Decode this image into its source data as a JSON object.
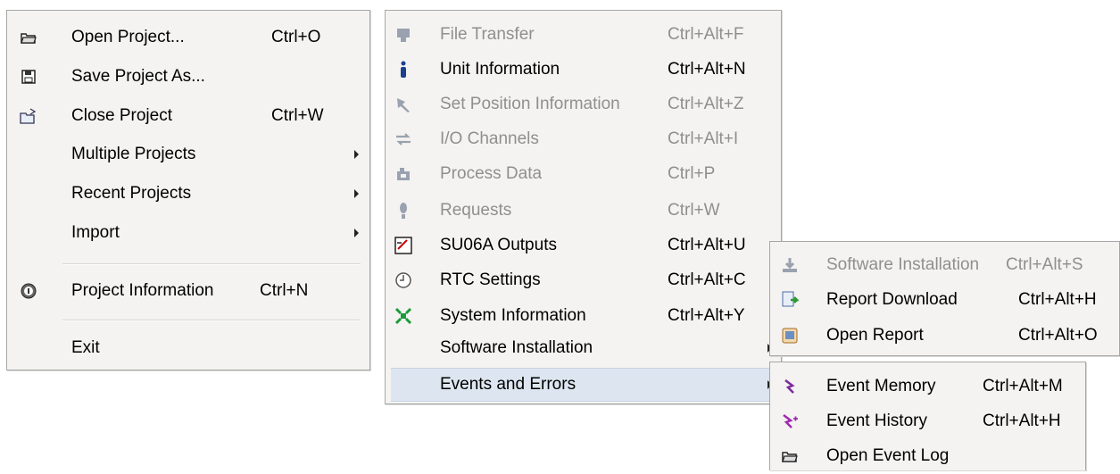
{
  "file_menu": {
    "items": [
      {
        "label": "Open Project...",
        "accel": "Ctrl+O",
        "icon": "folder-open-icon"
      },
      {
        "label": "Save Project As...",
        "accel": "",
        "icon": "floppy-save-icon"
      },
      {
        "label": "Close Project",
        "accel": "Ctrl+W",
        "icon": "folder-close-icon"
      },
      {
        "label": "Multiple Projects",
        "accel": ""
      },
      {
        "label": "Recent Projects",
        "accel": ""
      },
      {
        "label": "Import",
        "accel": ""
      },
      {
        "label": "Project Information",
        "accel": "Ctrl+N",
        "icon": "info-badge-icon"
      },
      {
        "label": "Exit",
        "accel": ""
      }
    ]
  },
  "device_menu": {
    "items": [
      {
        "label": "File Transfer",
        "accel": "Ctrl+Alt+F",
        "enabled": false,
        "icon": "file-transfer-icon"
      },
      {
        "label": "Unit Information",
        "accel": "Ctrl+Alt+N",
        "enabled": true,
        "icon": "info-icon"
      },
      {
        "label": "Set Position Information",
        "accel": "Ctrl+Alt+Z",
        "enabled": false,
        "icon": "pin-icon"
      },
      {
        "label": "I/O Channels",
        "accel": "Ctrl+Alt+I",
        "enabled": false,
        "icon": "arrows-exchange-icon"
      },
      {
        "label": "Process Data",
        "accel": "Ctrl+P",
        "enabled": false,
        "icon": "process-data-icon"
      },
      {
        "label": "Requests",
        "accel": "Ctrl+W",
        "enabled": false,
        "icon": "request-icon"
      },
      {
        "label": "SU06A Outputs",
        "accel": "Ctrl+Alt+U",
        "enabled": true,
        "icon": "gauge-icon"
      },
      {
        "label": "RTC Settings",
        "accel": "Ctrl+Alt+C",
        "enabled": true,
        "icon": "clock-icon"
      },
      {
        "label": "System Information",
        "accel": "Ctrl+Alt+Y",
        "enabled": true,
        "icon": "system-info-icon"
      },
      {
        "label": "Software Installation",
        "accel": "",
        "enabled": true
      },
      {
        "label": "Events and Errors",
        "accel": "",
        "enabled": true
      }
    ]
  },
  "software_submenu": {
    "items": [
      {
        "label": "Software Installation",
        "accel": "Ctrl+Alt+S",
        "enabled": false,
        "icon": "install-icon"
      },
      {
        "label": "Report Download",
        "accel": "Ctrl+Alt+H",
        "enabled": true,
        "icon": "report-download-icon"
      },
      {
        "label": "Open Report",
        "accel": "Ctrl+Alt+O",
        "enabled": true,
        "icon": "open-report-icon"
      }
    ]
  },
  "events_submenu": {
    "items": [
      {
        "label": "Event Memory",
        "accel": "Ctrl+Alt+M",
        "enabled": true,
        "icon": "event-memory-icon"
      },
      {
        "label": "Event History",
        "accel": "Ctrl+Alt+H",
        "enabled": true,
        "icon": "event-history-icon"
      },
      {
        "label": "Open Event Log",
        "accel": "",
        "enabled": true,
        "icon": "folder-open-icon"
      }
    ]
  },
  "colors": {
    "menu_bg": "#f4f3f1",
    "disabled_text": "#8f8f8f",
    "highlight": "#dde6f0"
  }
}
